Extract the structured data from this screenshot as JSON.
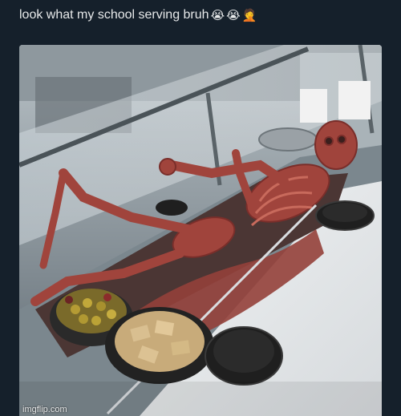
{
  "post": {
    "caption": "look what my school serving bruh",
    "caption_emojis": [
      "😭",
      "😭",
      "🤦"
    ]
  },
  "image": {
    "alt": "Cafeteria serving line with a life-size skeleton made of cured meat lying in a tray, next to bowls of olives and crackers and stacks of black plates",
    "watermark": "imgflip.com"
  },
  "colors": {
    "background": "#15202b",
    "caption_text": "#e7e9ea",
    "meat": "#a0443c",
    "counter": "#e6e9ea"
  }
}
